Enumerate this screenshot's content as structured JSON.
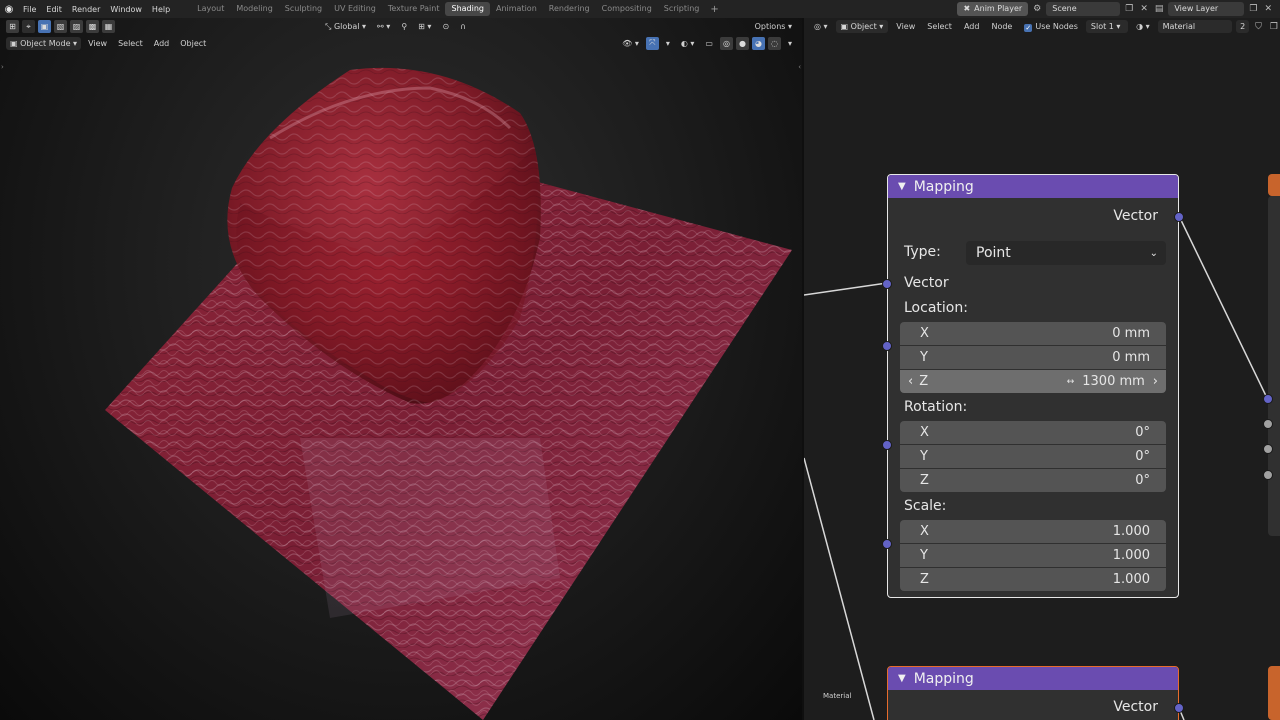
{
  "topbar": {
    "menus": [
      "File",
      "Edit",
      "Render",
      "Window",
      "Help"
    ],
    "workspaces": [
      "Layout",
      "Modeling",
      "Sculpting",
      "UV Editing",
      "Texture Paint",
      "Shading",
      "Animation",
      "Rendering",
      "Compositing",
      "Scripting"
    ],
    "active_workspace": "Shading",
    "add_tab": "+",
    "anim_player": "Anim Player",
    "scene": "Scene",
    "view_layer": "View Layer"
  },
  "viewport": {
    "mode": "Object Mode",
    "menus": [
      "View",
      "Select",
      "Add",
      "Object"
    ],
    "orientation": "Global",
    "options": "Options"
  },
  "node_editor": {
    "editor_type": "Object",
    "menus": [
      "View",
      "Select",
      "Add",
      "Node"
    ],
    "use_nodes": "Use Nodes",
    "slot": "Slot 1",
    "material": "Material",
    "user_count": "2",
    "frame_label": "Material"
  },
  "mapping_node": {
    "title": "Mapping",
    "output_vector": "Vector",
    "type_label": "Type:",
    "type_value": "Point",
    "input_vector": "Vector",
    "location_label": "Location:",
    "location": [
      {
        "axis": "X",
        "value": "0 mm"
      },
      {
        "axis": "Y",
        "value": "0 mm"
      },
      {
        "axis": "Z",
        "value": "1300 mm"
      }
    ],
    "rotation_label": "Rotation:",
    "rotation": [
      {
        "axis": "X",
        "value": "0°"
      },
      {
        "axis": "Y",
        "value": "0°"
      },
      {
        "axis": "Z",
        "value": "0°"
      }
    ],
    "scale_label": "Scale:",
    "scale": [
      {
        "axis": "X",
        "value": "1.000"
      },
      {
        "axis": "Y",
        "value": "1.000"
      },
      {
        "axis": "Z",
        "value": "1.000"
      }
    ]
  },
  "mapping_node_2": {
    "title": "Mapping",
    "output_vector": "Vector"
  },
  "colors": {
    "node_header": "#6a4cb0",
    "socket_vector": "#6363c7",
    "accent_blue": "#4772b3",
    "material_red": "#8c1a2c"
  }
}
